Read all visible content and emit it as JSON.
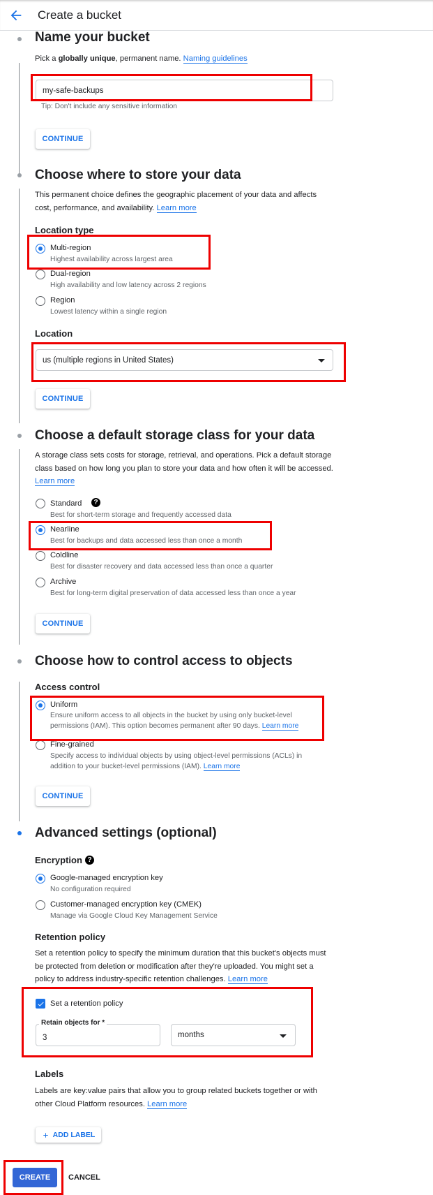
{
  "header": {
    "title": "Create a bucket",
    "back_icon": "arrow-left-icon"
  },
  "name_step": {
    "heading": "Name your bucket",
    "desc_prefix": "Pick a ",
    "desc_bold": "globally unique",
    "desc_suffix": ", permanent name.",
    "link": "Naming guidelines",
    "input_value": "my-safe-backups",
    "tip": "Tip: Don't include any sensitive information",
    "continue": "CONTINUE"
  },
  "location_step": {
    "heading": "Choose where to store your data",
    "desc": "This permanent choice defines the geographic placement of your data and affects cost, performance, and availability.",
    "link": "Learn more",
    "type_label": "Location type",
    "options": [
      {
        "label": "Multi-region",
        "desc": "Highest availability across largest area",
        "selected": true
      },
      {
        "label": "Dual-region",
        "desc": "High availability and low latency across 2 regions",
        "selected": false
      },
      {
        "label": "Region",
        "desc": "Lowest latency within a single region",
        "selected": false
      }
    ],
    "location_label": "Location",
    "location_value": "us (multiple regions in United States)",
    "continue": "CONTINUE"
  },
  "storage_step": {
    "heading": "Choose a default storage class for your data",
    "desc": "A storage class sets costs for storage, retrieval, and operations. Pick a default storage class based on how long you plan to store your data and how often it will be accessed.",
    "link": "Learn more",
    "options": [
      {
        "label": "Standard",
        "desc": "Best for short-term storage and frequently accessed data",
        "selected": false
      },
      {
        "label": "Nearline",
        "desc": "Best for backups and data accessed less than once a month",
        "selected": true
      },
      {
        "label": "Coldline",
        "desc": "Best for disaster recovery and data accessed less than once a quarter",
        "selected": false
      },
      {
        "label": "Archive",
        "desc": "Best for long-term digital preservation of data accessed less than once a year",
        "selected": false
      }
    ],
    "continue": "CONTINUE"
  },
  "access_step": {
    "heading": "Choose how to control access to objects",
    "label": "Access control",
    "options": [
      {
        "label": "Uniform",
        "desc": "Ensure uniform access to all objects in the bucket by using only bucket-level permissions (IAM). This option becomes permanent after 90 days.",
        "link": "Learn more",
        "selected": true
      },
      {
        "label": "Fine-grained",
        "desc": "Specify access to individual objects by using object-level permissions (ACLs) in addition to your bucket-level permissions (IAM).",
        "link": "Learn more",
        "selected": false
      }
    ],
    "continue": "CONTINUE"
  },
  "advanced_step": {
    "heading": "Advanced settings (optional)",
    "encryption": {
      "label": "Encryption",
      "options": [
        {
          "label": "Google-managed encryption key",
          "desc": "No configuration required",
          "selected": true
        },
        {
          "label": "Customer-managed encryption key (CMEK)",
          "desc": "Manage via Google Cloud Key Management Service",
          "selected": false
        }
      ]
    },
    "retention": {
      "label": "Retention policy",
      "desc": "Set a retention policy to specify the minimum duration that this bucket's objects must be protected from deletion or modification after they're uploaded. You might set a policy to address industry-specific retention challenges.",
      "link": "Learn more",
      "checkbox_label": "Set a retention policy",
      "checked": true,
      "retain_label": "Retain objects for *",
      "retain_value": "3",
      "unit_value": "months"
    },
    "labels": {
      "label": "Labels",
      "desc": "Labels are key:value pairs that allow you to group related buckets together or with other Cloud Platform resources.",
      "link": "Learn more",
      "add_button": "ADD LABEL"
    }
  },
  "actions": {
    "create": "CREATE",
    "cancel": "CANCEL"
  },
  "colors": {
    "accent": "#1a73e8",
    "create_button": "#3367d6",
    "highlight": "#ee0000"
  }
}
